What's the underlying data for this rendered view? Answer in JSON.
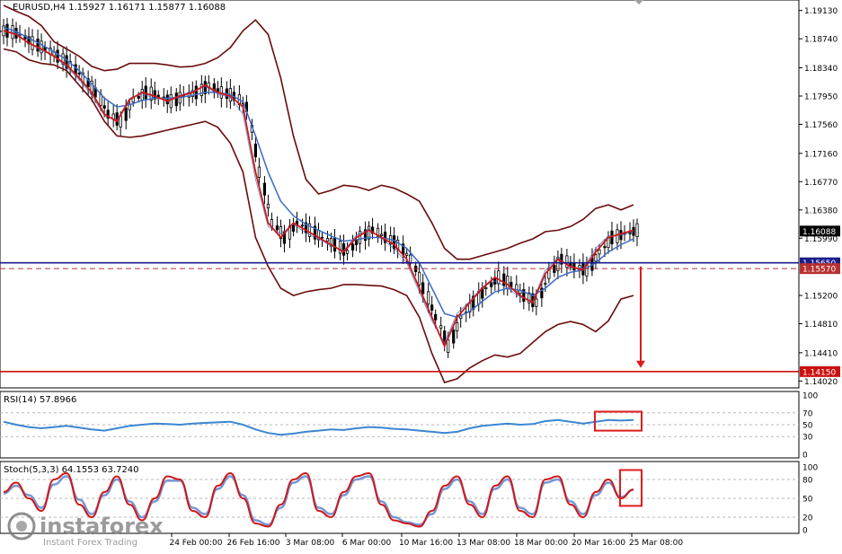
{
  "chart_data": [
    {
      "type": "line",
      "kind": "candlestick-price",
      "title": "EURUSD,H4  1.15927 1.16171 1.15877 1.16088",
      "y_ticks": [
        "1.19130",
        "1.18740",
        "1.18340",
        "1.17950",
        "1.17560",
        "1.17160",
        "1.16770",
        "1.16380",
        "1.15990",
        "1.15200",
        "1.14810",
        "1.14410",
        "1.14020"
      ],
      "ylim": [
        1.1395,
        1.1925
      ],
      "x_tick_labels": [
        "24 Feb 00:00",
        "26 Feb 16:00",
        "3 Mar 08:00",
        "6 Mar 00:00",
        "10 Mar 16:00",
        "13 Mar 08:00",
        "18 Mar 00:00",
        "20 Mar 16:00",
        "25 Mar 08:00"
      ],
      "series": [
        {
          "values": [
            1.1885,
            1.188,
            1.1868,
            1.186,
            1.185,
            1.1838,
            1.182,
            1.18,
            1.177,
            1.176,
            1.179,
            1.18,
            1.1795,
            1.1788,
            1.1795,
            1.18,
            1.181,
            1.18,
            1.1795,
            1.178,
            1.169,
            1.162,
            1.16,
            1.162,
            1.161,
            1.16,
            1.159,
            1.158,
            1.16,
            1.161,
            1.16,
            1.159,
            1.157,
            1.153,
            1.149,
            1.145,
            1.149,
            1.151,
            1.153,
            1.1545,
            1.1535,
            1.152,
            1.151,
            1.155,
            1.157,
            1.156,
            1.1555,
            1.158,
            1.16,
            1.1605,
            1.161
          ]
        },
        {
          "values": [
            1.189,
            1.1884,
            1.1875,
            1.1866,
            1.1856,
            1.1845,
            1.183,
            1.1812,
            1.1792,
            1.178,
            1.1783,
            1.1789,
            1.1792,
            1.1792,
            1.1793,
            1.1796,
            1.18,
            1.18,
            1.1797,
            1.1787,
            1.174,
            1.169,
            1.165,
            1.163,
            1.1618,
            1.161,
            1.1602,
            1.1595,
            1.1597,
            1.16,
            1.16,
            1.1596,
            1.1585,
            1.1565,
            1.153,
            1.1495,
            1.149,
            1.1498,
            1.1512,
            1.1525,
            1.153,
            1.1527,
            1.152,
            1.153,
            1.1545,
            1.1552,
            1.1555,
            1.1565,
            1.158,
            1.159,
            1.1598
          ]
        },
        {
          "values": [
            1.1885,
            1.1882,
            1.1868,
            1.1858,
            1.185,
            1.1835,
            1.1818,
            1.1796,
            1.1768,
            1.1762,
            1.1792,
            1.1798,
            1.1792,
            1.179,
            1.1796,
            1.1802,
            1.1808,
            1.1798,
            1.1793,
            1.177,
            1.168,
            1.1615,
            1.1605,
            1.1618,
            1.1606,
            1.1598,
            1.1588,
            1.1582,
            1.1603,
            1.1612,
            1.1598,
            1.1585,
            1.1565,
            1.1525,
            1.1485,
            1.1455,
            1.1495,
            1.1512,
            1.1532,
            1.154,
            1.153,
            1.1518,
            1.1512,
            1.1555,
            1.1572,
            1.1558,
            1.1558,
            1.1585,
            1.1602,
            1.1603,
            1.1608
          ]
        },
        {
          "values": [
            1.192,
            1.1912,
            1.1905,
            1.1892,
            1.187,
            1.186,
            1.185,
            1.1836,
            1.183,
            1.1832,
            1.184,
            1.184,
            1.184,
            1.1838,
            1.1835,
            1.1836,
            1.184,
            1.1848,
            1.1862,
            1.1885,
            1.19,
            1.188,
            1.182,
            1.174,
            1.168,
            1.166,
            1.1665,
            1.1672,
            1.167,
            1.1665,
            1.1672,
            1.1668,
            1.166,
            1.165,
            1.162,
            1.1585,
            1.157,
            1.157,
            1.1575,
            1.158,
            1.1585,
            1.1592,
            1.1598,
            1.1608,
            1.161,
            1.1615,
            1.1625,
            1.164,
            1.1645,
            1.1638,
            1.1645
          ]
        },
        {
          "values": [
            1.186,
            1.1856,
            1.1845,
            1.184,
            1.1838,
            1.183,
            1.181,
            1.179,
            1.176,
            1.174,
            1.1738,
            1.174,
            1.1744,
            1.1748,
            1.1752,
            1.1756,
            1.176,
            1.1752,
            1.173,
            1.169,
            1.16,
            1.156,
            1.153,
            1.152,
            1.1525,
            1.1528,
            1.153,
            1.1535,
            1.1535,
            1.1534,
            1.1533,
            1.1528,
            1.152,
            1.149,
            1.144,
            1.14,
            1.1405,
            1.142,
            1.143,
            1.1438,
            1.1435,
            1.144,
            1.1455,
            1.147,
            1.148,
            1.1484,
            1.148,
            1.147,
            1.1485,
            1.1515,
            1.152
          ]
        }
      ],
      "hlines": [
        {
          "price_label": "1.15650",
          "value": 1.1565,
          "color": "#1b1b8c"
        },
        {
          "price_label": "1.15570",
          "value": 1.1557,
          "color": "#b83030"
        },
        {
          "price_label": "1.14150",
          "value": 1.1415,
          "color": "#cc1111"
        }
      ],
      "current_price_label": "1.16088",
      "current_price": 1.16088,
      "forecast_arrow": {
        "from": 1.156,
        "to": 1.142,
        "color": "#dd1c1c"
      }
    },
    {
      "type": "line",
      "title": "RSI(14) 57.8966",
      "y_ticks": [
        "100",
        "70",
        "50",
        "30",
        "0"
      ],
      "ylim": [
        0,
        100
      ],
      "levels": [
        70,
        50,
        30
      ],
      "values": [
        55,
        50,
        46,
        44,
        46,
        48,
        45,
        42,
        40,
        44,
        48,
        50,
        52,
        51,
        50,
        52,
        53,
        54,
        55,
        50,
        42,
        36,
        33,
        35,
        38,
        40,
        42,
        41,
        44,
        46,
        45,
        43,
        42,
        40,
        38,
        36,
        38,
        44,
        48,
        50,
        52,
        50,
        51,
        56,
        58,
        55,
        52,
        55,
        58,
        57,
        57.9
      ]
    },
    {
      "type": "line",
      "title": "Stoch(5,3,3) 64.1553 63.7240",
      "y_ticks": [
        "100",
        "80",
        "50",
        "20",
        "0"
      ],
      "ylim": [
        0,
        100
      ],
      "levels": [
        80,
        50,
        20
      ],
      "series": [
        {
          "values": [
            60,
            75,
            50,
            30,
            80,
            90,
            40,
            20,
            60,
            85,
            40,
            15,
            50,
            85,
            80,
            30,
            20,
            70,
            90,
            50,
            10,
            5,
            40,
            80,
            90,
            30,
            20,
            60,
            85,
            90,
            40,
            15,
            10,
            5,
            30,
            70,
            85,
            40,
            20,
            70,
            85,
            30,
            20,
            80,
            85,
            40,
            20,
            60,
            80,
            50,
            64
          ]
        },
        {
          "values": [
            58,
            70,
            55,
            35,
            72,
            85,
            48,
            25,
            55,
            80,
            45,
            20,
            45,
            78,
            78,
            35,
            25,
            65,
            85,
            55,
            15,
            8,
            35,
            75,
            85,
            35,
            25,
            55,
            80,
            85,
            45,
            20,
            12,
            8,
            25,
            65,
            80,
            45,
            25,
            65,
            80,
            35,
            25,
            75,
            80,
            45,
            25,
            55,
            75,
            52,
            63.7
          ]
        }
      ]
    }
  ],
  "watermark": {
    "brand": "instaforex",
    "tagline": "Instant Forex Trading"
  },
  "colors": {
    "ma_fast": "#d01818",
    "ma_slow": "#3d6bc4",
    "bands": "#6a0c0c",
    "candles": "#000000",
    "rsi_line": "#3b86d1",
    "stoch_main": "#d01818",
    "stoch_signal": "#7896d4",
    "annotation_box": "#dd1c1c"
  }
}
